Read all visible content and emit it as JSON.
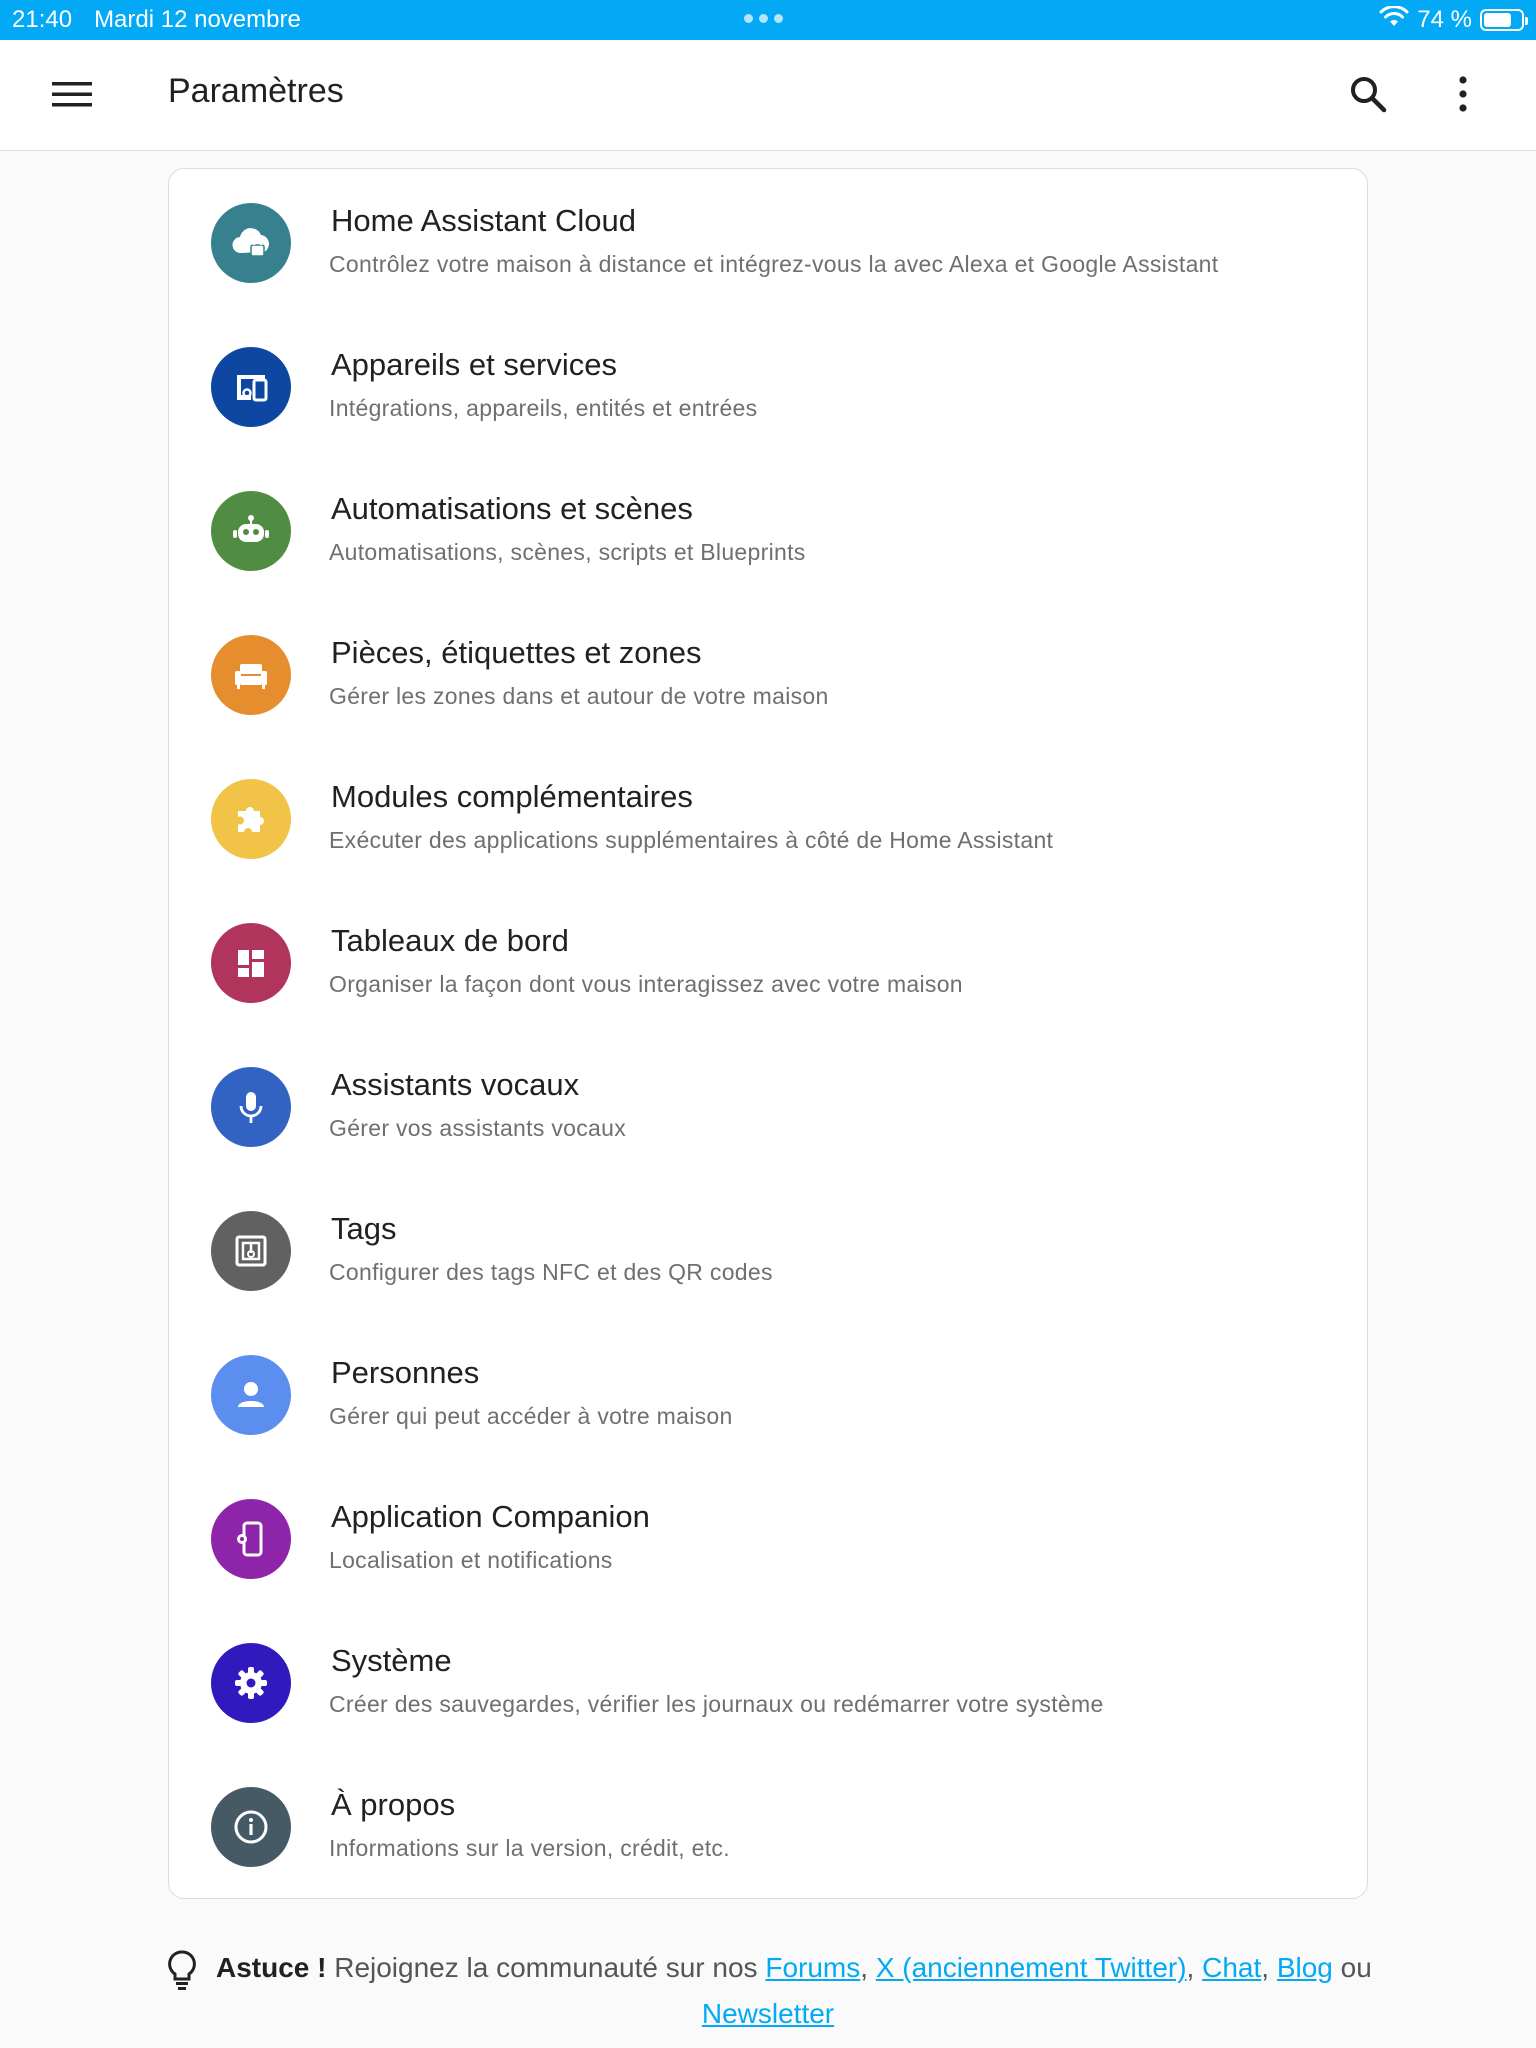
{
  "status_bar": {
    "time": "21:40",
    "date": "Mardi 12 novembre",
    "battery": "74 %",
    "battery_level": 0.74
  },
  "app_bar": {
    "title": "Paramètres"
  },
  "settings": {
    "items": [
      {
        "label": "Home Assistant Cloud",
        "desc": "Contrôlez votre maison à distance et intégrez-vous la avec Alexa et Google Assistant",
        "icon": "cloud-lock-icon",
        "color": "#37818e"
      },
      {
        "label": "Appareils et services",
        "desc": "Intégrations, appareils, entités et entrées",
        "icon": "devices-icon",
        "color": "#0d47a1"
      },
      {
        "label": "Automatisations et scènes",
        "desc": "Automatisations, scènes, scripts et Blueprints",
        "icon": "robot-icon",
        "color": "#518c43"
      },
      {
        "label": "Pièces, étiquettes et zones",
        "desc": "Gérer les zones dans et autour de votre maison",
        "icon": "sofa-icon",
        "color": "#e68d2d"
      },
      {
        "label": "Modules complémentaires",
        "desc": "Exécuter des applications supplémentaires à côté de Home Assistant",
        "icon": "puzzle-icon",
        "color": "#f1c447"
      },
      {
        "label": "Tableaux de bord",
        "desc": "Organiser la façon dont vous interagissez avec votre maison",
        "icon": "dashboard-icon",
        "color": "#b1345c"
      },
      {
        "label": "Assistants vocaux",
        "desc": "Gérer vos assistants vocaux",
        "icon": "microphone-icon",
        "color": "#3263c3"
      },
      {
        "label": "Tags",
        "desc": "Configurer des tags NFC et des QR codes",
        "icon": "nfc-icon",
        "color": "#616161"
      },
      {
        "label": "Personnes",
        "desc": "Gérer qui peut accéder à votre maison",
        "icon": "person-icon",
        "color": "#5c8ef0"
      },
      {
        "label": "Application Companion",
        "desc": "Localisation et notifications",
        "icon": "cellphone-cog-icon",
        "color": "#8e24aa"
      },
      {
        "label": "Système",
        "desc": "Créer des sauvegardes, vérifier les journaux ou redémarrer votre système",
        "icon": "cog-icon",
        "color": "#301abe"
      },
      {
        "label": "À propos",
        "desc": "Informations sur la version, crédit, etc.",
        "icon": "info-icon",
        "color": "#465a65"
      }
    ]
  },
  "tip": {
    "title": "Astuce !",
    "text": "Rejoignez la communauté sur nos",
    "links": [
      "Forums",
      "X (anciennement Twitter)",
      "Chat",
      "Blog",
      "Newsletter"
    ],
    "sep": ",",
    "or": "ou",
    "link_color": "#03a9f4"
  },
  "accent_color": "#03a9f4"
}
